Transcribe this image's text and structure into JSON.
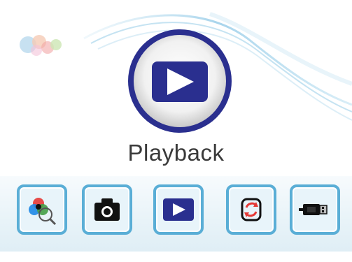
{
  "screen": {
    "title": "Playback",
    "accent_color": "#2a2f8f",
    "frame_color": "#5aaed6"
  },
  "menu": {
    "items": [
      {
        "name": "color-settings",
        "icon": "color-magnifier-icon"
      },
      {
        "name": "camera",
        "icon": "camera-icon"
      },
      {
        "name": "playback",
        "icon": "play-icon",
        "selected": true
      },
      {
        "name": "rotate",
        "icon": "rotate-icon"
      },
      {
        "name": "usb",
        "icon": "usb-plug-icon"
      }
    ]
  }
}
